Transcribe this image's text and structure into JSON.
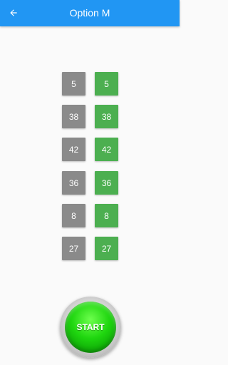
{
  "app_bar": {
    "title": "Option M",
    "back_icon": "arrow-left-icon",
    "color": "#2196f3"
  },
  "pairs": [
    {
      "left": "5",
      "right": "5"
    },
    {
      "left": "38",
      "right": "38"
    },
    {
      "left": "42",
      "right": "42"
    },
    {
      "left": "36",
      "right": "36"
    },
    {
      "left": "8",
      "right": "8"
    },
    {
      "left": "27",
      "right": "27"
    }
  ],
  "colors": {
    "left_tile": "#8a8a8a",
    "right_tile": "#4caf50",
    "start_button": "#1fd60f"
  },
  "start_button": {
    "label": "START"
  }
}
